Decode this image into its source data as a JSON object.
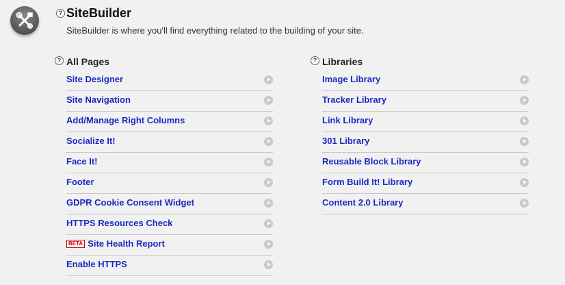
{
  "header": {
    "title": "SiteBuilder",
    "description": "SiteBuilder is where you'll find everything related to the building of your site.",
    "help_glyph": "?",
    "logo_icon": "tools-icon"
  },
  "all_pages": {
    "heading": "All Pages",
    "items": [
      {
        "label": "Site Designer"
      },
      {
        "label": "Site Navigation"
      },
      {
        "label": "Add/Manage Right Columns"
      },
      {
        "label": "Socialize It!"
      },
      {
        "label": "Face It!"
      },
      {
        "label": "Footer"
      },
      {
        "label": "GDPR Cookie Consent Widget"
      },
      {
        "label": "HTTPS Resources Check"
      },
      {
        "label": "Site Health Report",
        "badge": "BETA"
      },
      {
        "label": "Enable HTTPS"
      }
    ]
  },
  "libraries": {
    "heading": "Libraries",
    "items": [
      {
        "label": "Image Library"
      },
      {
        "label": "Tracker Library"
      },
      {
        "label": "Link Library"
      },
      {
        "label": "301 Library"
      },
      {
        "label": "Reusable Block Library"
      },
      {
        "label": "Form Build It! Library"
      },
      {
        "label": "Content 2.0 Library"
      }
    ]
  },
  "colors": {
    "link": "#1a2ac0",
    "beta": "#cc0000",
    "divider": "#c9c9c9",
    "arrow": "#c9c9c9"
  }
}
